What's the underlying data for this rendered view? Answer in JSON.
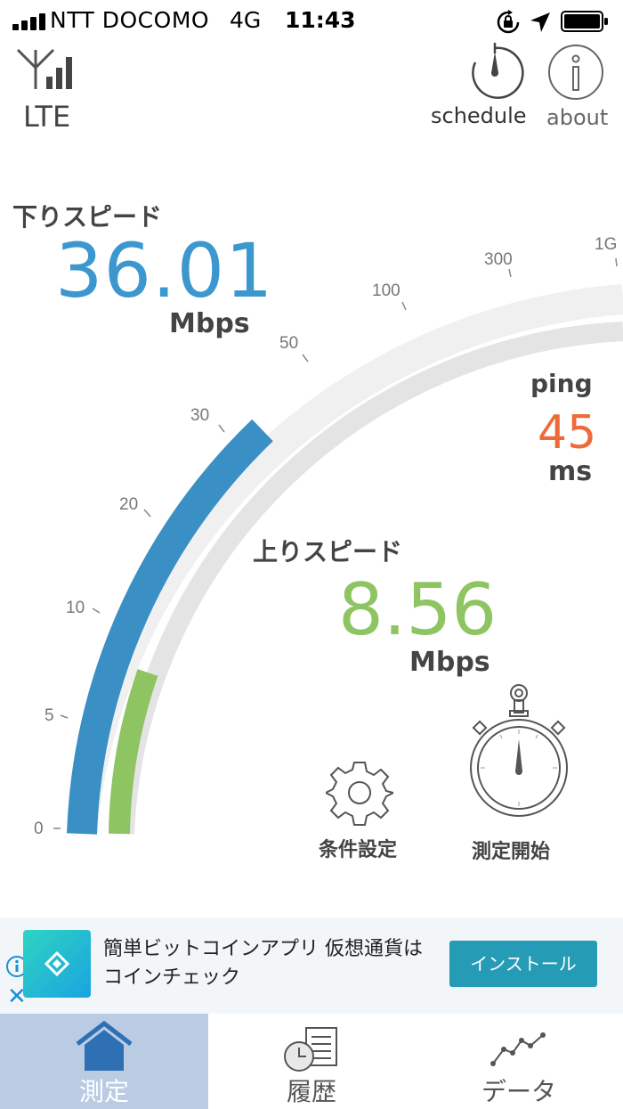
{
  "status_bar": {
    "carrier": "NTT DOCOMO",
    "network": "4G",
    "time": "11:43"
  },
  "header": {
    "connection_type": "LTE",
    "schedule_label": "schedule",
    "about_label": "about"
  },
  "gauge": {
    "ticks": [
      "0",
      "5",
      "10",
      "20",
      "30",
      "50",
      "100",
      "300",
      "1G"
    ],
    "download_fill_level": "30",
    "upload_fill_level": "8.56"
  },
  "download": {
    "label": "下りスピード",
    "value": "36.01",
    "unit": "Mbps"
  },
  "upload": {
    "label": "上りスピード",
    "value": "8.56",
    "unit": "Mbps"
  },
  "ping": {
    "label": "ping",
    "value": "45",
    "unit": "ms"
  },
  "actions": {
    "settings_label": "条件設定",
    "start_label": "測定開始"
  },
  "ad": {
    "text": "簡単ビットコインアプリ 仮想通貨はコインチェック",
    "button_label": "インストール"
  },
  "tabs": [
    {
      "label": "測定",
      "active": true
    },
    {
      "label": "履歴",
      "active": false
    },
    {
      "label": "データ",
      "active": false
    }
  ],
  "colors": {
    "download": "#3d97cf",
    "upload": "#8ec461",
    "ping": "#ee6a3a",
    "track": "#e3e3e3",
    "active_tab": "#b9cce4",
    "install_button": "#269bb5"
  }
}
